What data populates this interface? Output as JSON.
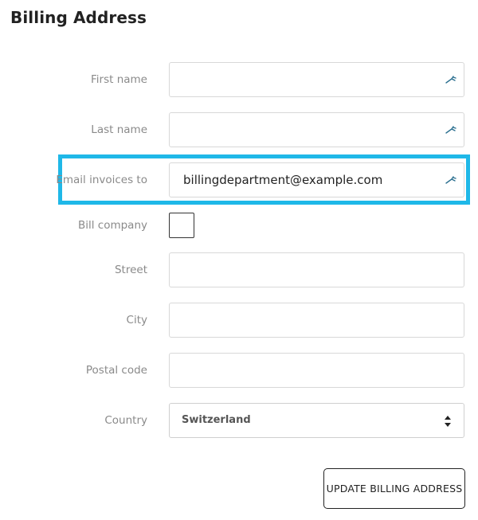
{
  "page_title": "Billing Address",
  "form": {
    "first_name": {
      "label": "First name",
      "value": ""
    },
    "last_name": {
      "label": "Last name",
      "value": ""
    },
    "email_invoices": {
      "label": "Email invoices to",
      "value": "billingdepartment@example.com"
    },
    "bill_company": {
      "label": "Bill company",
      "checked": false
    },
    "street": {
      "label": "Street",
      "value": ""
    },
    "city": {
      "label": "City",
      "value": ""
    },
    "postal_code": {
      "label": "Postal code",
      "value": ""
    },
    "country": {
      "label": "Country",
      "selected": "Switzerland"
    }
  },
  "update_button_label": "UPDATE BILLING ADDRESS",
  "colors": {
    "highlight": "#1fb8e8",
    "autofill_icon": "#2a6f8f"
  },
  "icons": {
    "autofill": "autofill-key-icon",
    "select": "select-arrows-icon"
  }
}
